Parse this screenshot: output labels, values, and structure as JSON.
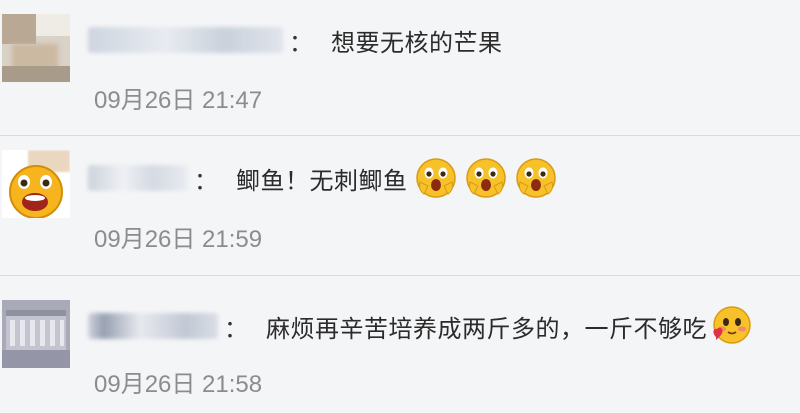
{
  "comments": [
    {
      "text": "想要无核的芒果",
      "time": "09月26日 21:47",
      "emojis": []
    },
    {
      "text": "鲫鱼！无刺鲫鱼",
      "time": "09月26日 21:59",
      "emojis": [
        "scream-face-icon",
        "scream-face-icon",
        "scream-face-icon"
      ]
    },
    {
      "text": "麻烦再辛苦培养成两斤多的，一斤不够吃",
      "time": "09月26日 21:58",
      "emojis": [
        "blushing-heart-face-icon"
      ]
    }
  ],
  "colon": "："
}
